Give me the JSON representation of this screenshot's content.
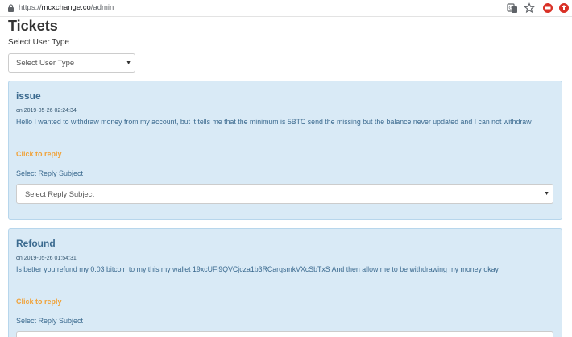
{
  "browser": {
    "url_scheme": "https://",
    "url_host": "mcxchange.co",
    "url_path": "/admin",
    "icons": [
      "lock-icon",
      "translate-icon",
      "star-icon",
      "extension-icon",
      "extension-icon"
    ],
    "colors": {
      "ext1": "#d93025",
      "ext2": "#d93025"
    }
  },
  "page": {
    "title": "Tickets",
    "user_type_label": "Select User Type",
    "user_type_select": "Select User Type",
    "caret": "▼"
  },
  "tickets": [
    {
      "subject": "issue",
      "date": "on 2019-05-26 02:24:34",
      "message": "Hello I wanted to withdraw money from my account, but it tells me that the minimum is 5BTC send the missing but the balance never updated and I can not withdraw",
      "reply_link": "Click to reply",
      "reply_label": "Select Reply Subject",
      "reply_select": "Select Reply Subject"
    },
    {
      "subject": "Refound",
      "date": "on 2019-05-26 01:54:31",
      "message": "Is better you refund my 0.03 bitcoin to my this my wallet 19xcUFi9QVCjcza1b3RCarqsmkVXcSbTxS And then allow me to be withdrawing my money okay",
      "reply_link": "Click to reply",
      "reply_label": "Select Reply Subject",
      "reply_select": ""
    }
  ],
  "colors": {
    "card_bg": "#d9eaf6",
    "card_border": "#b7d6ec",
    "card_text": "#3b6a8f",
    "reply_link": "#f0a33b"
  }
}
